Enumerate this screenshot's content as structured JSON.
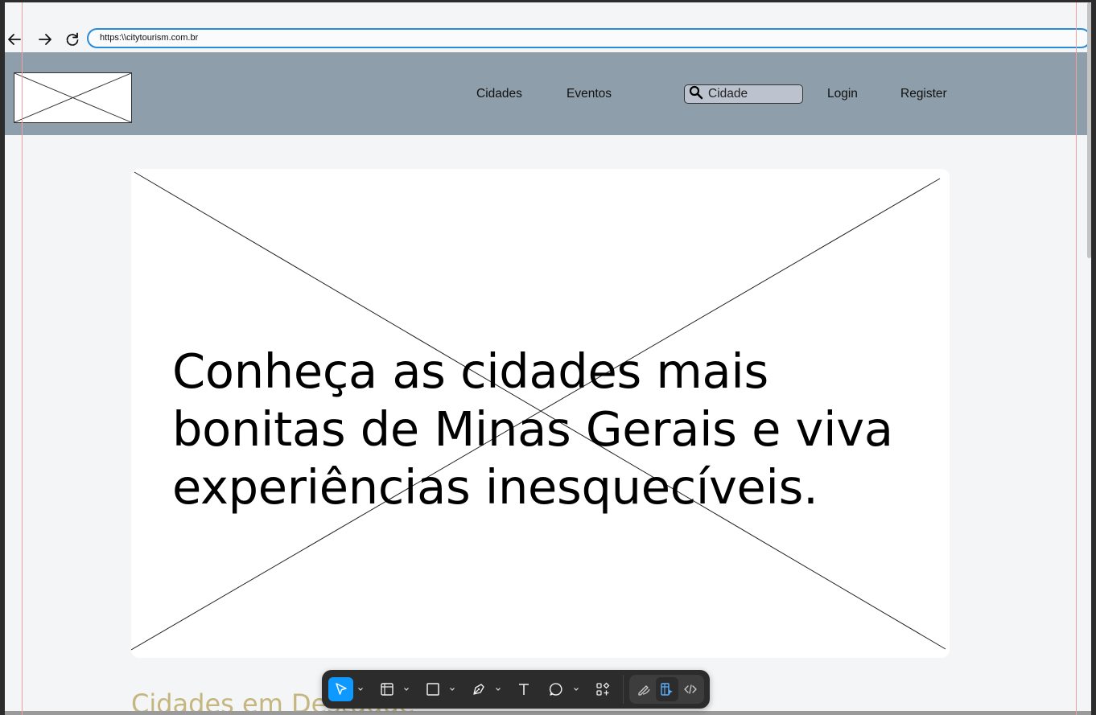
{
  "browser": {
    "url": "https:\\\\citytourism.com.br"
  },
  "header": {
    "nav": [
      "Cidades",
      "Eventos"
    ],
    "search_placeholder": "Cidade",
    "login_label": "Login",
    "register_label": "Register"
  },
  "hero": {
    "text": "Conheça as cidades mais bonitas de Minas Gerais e viva experiências inesquecíveis."
  },
  "section": {
    "title": "Cidades em Destaque"
  },
  "colors": {
    "header_bg": "#8e9fab",
    "page_bg": "#f4f5f7",
    "accent": "#0d99ff",
    "section_title": "#c4b67e"
  },
  "toolbar": {
    "tools": [
      "move-icon",
      "frame-icon",
      "rectangle-icon",
      "pen-icon",
      "text-icon",
      "comment-icon",
      "components-icon",
      "draw-icon",
      "design-mode-icon",
      "dev-mode-icon"
    ],
    "active_tool": "move-icon"
  }
}
